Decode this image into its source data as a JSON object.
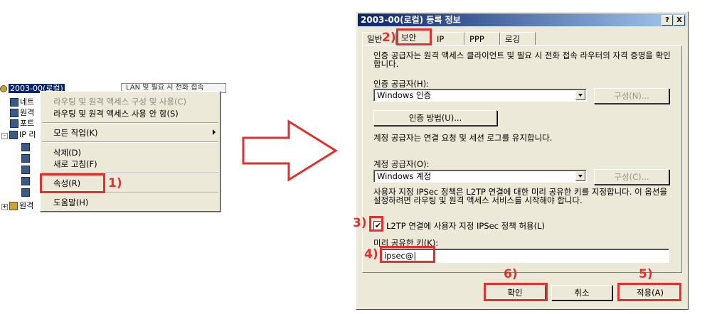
{
  "colors": {
    "annotation": "#e03131",
    "title_bar": "#0a246a",
    "face": "#ece9d8"
  },
  "tree": {
    "items": [
      {
        "label": "2003-00(로컬)",
        "selected": true
      },
      {
        "label": "네트"
      },
      {
        "label": "원격"
      },
      {
        "label": "포트"
      },
      {
        "label": "IP 리"
      },
      {
        "label": "원격"
      }
    ],
    "lan_header": "LAN 및 필요 시 전화 접속"
  },
  "context_menu": {
    "items": [
      {
        "label": "라우팅 및 원격 액세스 구성 및 사용(C)",
        "disabled": true
      },
      {
        "label": "라우팅 및 원격 액세스 사용 안 함(S)"
      },
      {
        "label": "모든 작업(K)",
        "submenu": true
      },
      {
        "label": "삭제(D)"
      },
      {
        "label": "새로 고침(F)"
      },
      {
        "label": "속성(R)"
      },
      {
        "label": "도움말(H)"
      }
    ]
  },
  "steps": [
    "1)",
    "2)",
    "3)",
    "4)",
    "5)",
    "6)"
  ],
  "dialog": {
    "title": "2003-00(로컬) 등록 정보",
    "help_btn": "?",
    "close_btn": "X",
    "tabs": [
      "일반",
      "보안",
      "IP",
      "PPP",
      "로깅"
    ],
    "auth_description": "인증 공급자는 원격 액세스 클라이언트 및 필요 시 전화 접속 라우터의 자격 증명을 확인합니다.",
    "auth_provider_label": "인증 공급자(H):",
    "auth_provider_value": "Windows 인증",
    "configure_1": "구성(N)...",
    "auth_methods_button": "인증 방법(U)...",
    "acct_description": "계정 공급자는 연결 요청 및 세션 로그를 유지합니다.",
    "acct_provider_label": "계정 공급자(O):",
    "acct_provider_value": "Windows 계정",
    "configure_2": "구성(C)...",
    "ipsec_description": "사용자 지정 IPSec 정책은 L2TP 연결에 대한 미리 공유한 키를 지정합니다. 이 옵션을 설정하려면 라우팅 및 원격 액세스 서비스를 시작해야 합니다.",
    "ipsec_checkbox_label": "L2TP 연결에 사용자 지정 IPSec 정책 허용(L)",
    "ipsec_checked": true,
    "preshared_key_label": "미리 공유한 키(K):",
    "preshared_key_value": "ipsec@|",
    "ok_button": "확인",
    "cancel_button": "취소",
    "apply_button": "적용(A)"
  }
}
